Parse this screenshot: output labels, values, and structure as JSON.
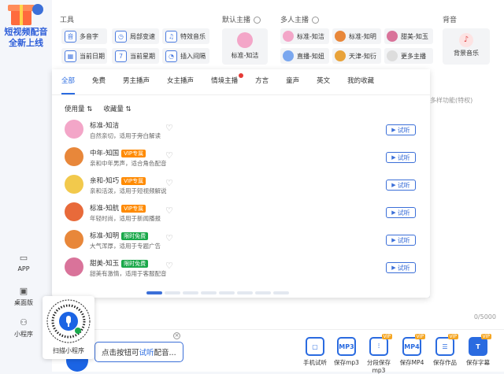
{
  "promo": {
    "line1": "短视频配音",
    "line2": "全新上线"
  },
  "left_nav": [
    {
      "label": "APP",
      "icon": "app-icon"
    },
    {
      "label": "桌面版",
      "icon": "desktop-icon"
    },
    {
      "label": "小程序",
      "icon": "miniprogram-icon"
    }
  ],
  "toolbar": {
    "tools_title": "工具",
    "tools": [
      {
        "label": "多音字",
        "glyph": "音"
      },
      {
        "label": "局部变速",
        "glyph": "◷"
      },
      {
        "label": "特效音乐",
        "glyph": "♫"
      },
      {
        "label": "当前日期",
        "glyph": "▦"
      },
      {
        "label": "当前星期",
        "glyph": "7"
      },
      {
        "label": "插入间隔",
        "glyph": "◔"
      }
    ],
    "default_anchor_title": "默认主播",
    "default_anchor": "标准-知洁",
    "multi_anchor_title": "多人主播",
    "multi_anchors": [
      "标准-知洁",
      "标准-知明",
      "甜美-知玉",
      "直播-知妞",
      "天津-知衍",
      "更多主播"
    ],
    "bg_title": "背音",
    "bg_label": "背景音乐"
  },
  "panel": {
    "tabs": [
      "全部",
      "免费",
      "男主播声",
      "女主播声",
      "情境主播",
      "方言",
      "童声",
      "英文",
      "我的收藏"
    ],
    "active_tab": "全部",
    "sorts": [
      "使用量 ⇅",
      "收藏量 ⇅"
    ],
    "listen_label": "试听",
    "voices": [
      {
        "name": "标准-知洁",
        "badge": "",
        "badge_type": "",
        "desc": "自然亲切，适用于旁白解读",
        "color": "#f3a6c8"
      },
      {
        "name": "中年-知国",
        "badge": "VIP专属",
        "badge_type": "vip",
        "desc": "亲和中年男声，适合角色配音",
        "color": "#e8873a"
      },
      {
        "name": "亲和-知巧",
        "badge": "VIP专属",
        "badge_type": "vip",
        "desc": "亲和活泼，适用于短视频解说",
        "color": "#f2c94c"
      },
      {
        "name": "标准-知航",
        "badge": "VIP专属",
        "badge_type": "vip",
        "desc": "年轻时尚，适用于新闻播报",
        "color": "#e86a3a"
      },
      {
        "name": "标准-知明",
        "badge": "限时免费",
        "badge_type": "free",
        "desc": "大气浑厚，适用于专题广告",
        "color": "#e8873a"
      },
      {
        "name": "甜美-知玉",
        "badge": "限时免费",
        "badge_type": "free",
        "desc": "甜美有激情，适用于客服配音",
        "color": "#d9739a"
      }
    ]
  },
  "editor": {
    "hint": "多样功能(特权)",
    "counter": "0/5000"
  },
  "qr": {
    "caption": "扫描小程序"
  },
  "tooltip": {
    "prefix": "点击按钮可",
    "highlight": "试听",
    "suffix": "配音..."
  },
  "actions": [
    {
      "label": "手机试听",
      "glyph": "▢",
      "vip": ""
    },
    {
      "label": "保存mp3",
      "glyph": "MP3",
      "vip": ""
    },
    {
      "label": "分段保存mp3",
      "glyph": "⫶",
      "vip": "VIP"
    },
    {
      "label": "保存MP4",
      "glyph": "MP4",
      "vip": "VIP"
    },
    {
      "label": "保存作品",
      "glyph": "☰",
      "vip": "VIP"
    },
    {
      "label": "保存字幕",
      "glyph": "T",
      "vip": "VIP"
    }
  ]
}
